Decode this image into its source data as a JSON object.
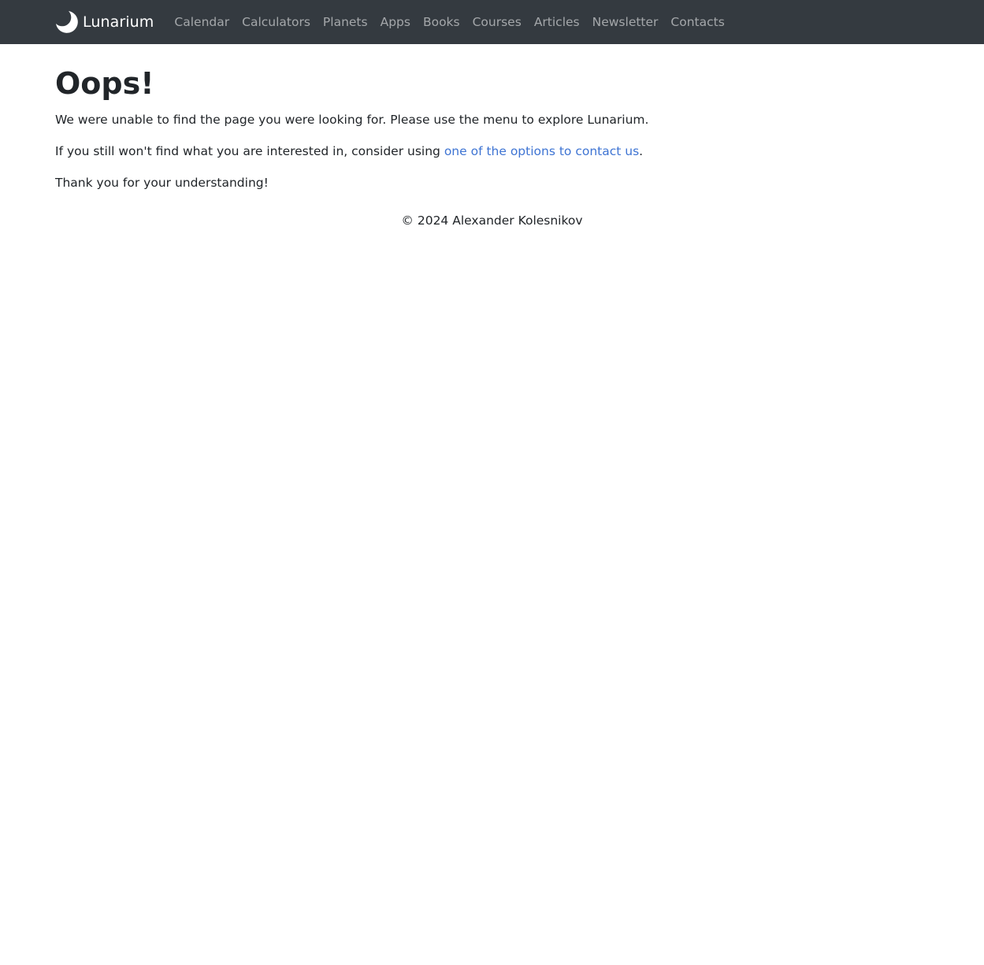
{
  "navbar": {
    "brand": {
      "icon": "crescent-moon-icon",
      "label": "Lunarium"
    },
    "items": [
      {
        "label": "Calendar"
      },
      {
        "label": "Calculators"
      },
      {
        "label": "Planets"
      },
      {
        "label": "Apps"
      },
      {
        "label": "Books"
      },
      {
        "label": "Courses"
      },
      {
        "label": "Articles"
      },
      {
        "label": "Newsletter"
      },
      {
        "label": "Contacts"
      }
    ],
    "colors": {
      "background": "#343a40",
      "link": "rgba(255,255,255,0.55)",
      "brand": "#ffffff"
    }
  },
  "main": {
    "title": "Oops!",
    "paragraph1": "We were unable to find the page you were looking for. Please use the menu to explore Lunarium.",
    "paragraph2_prefix": "If you still won't find what you are interested in, consider using ",
    "paragraph2_link": "one of the options to contact us",
    "paragraph2_suffix": ".",
    "paragraph3": "Thank you for your understanding!",
    "link_color": "#3e74d3"
  },
  "footer": {
    "copyright": "© 2024 Alexander Kolesnikov"
  }
}
